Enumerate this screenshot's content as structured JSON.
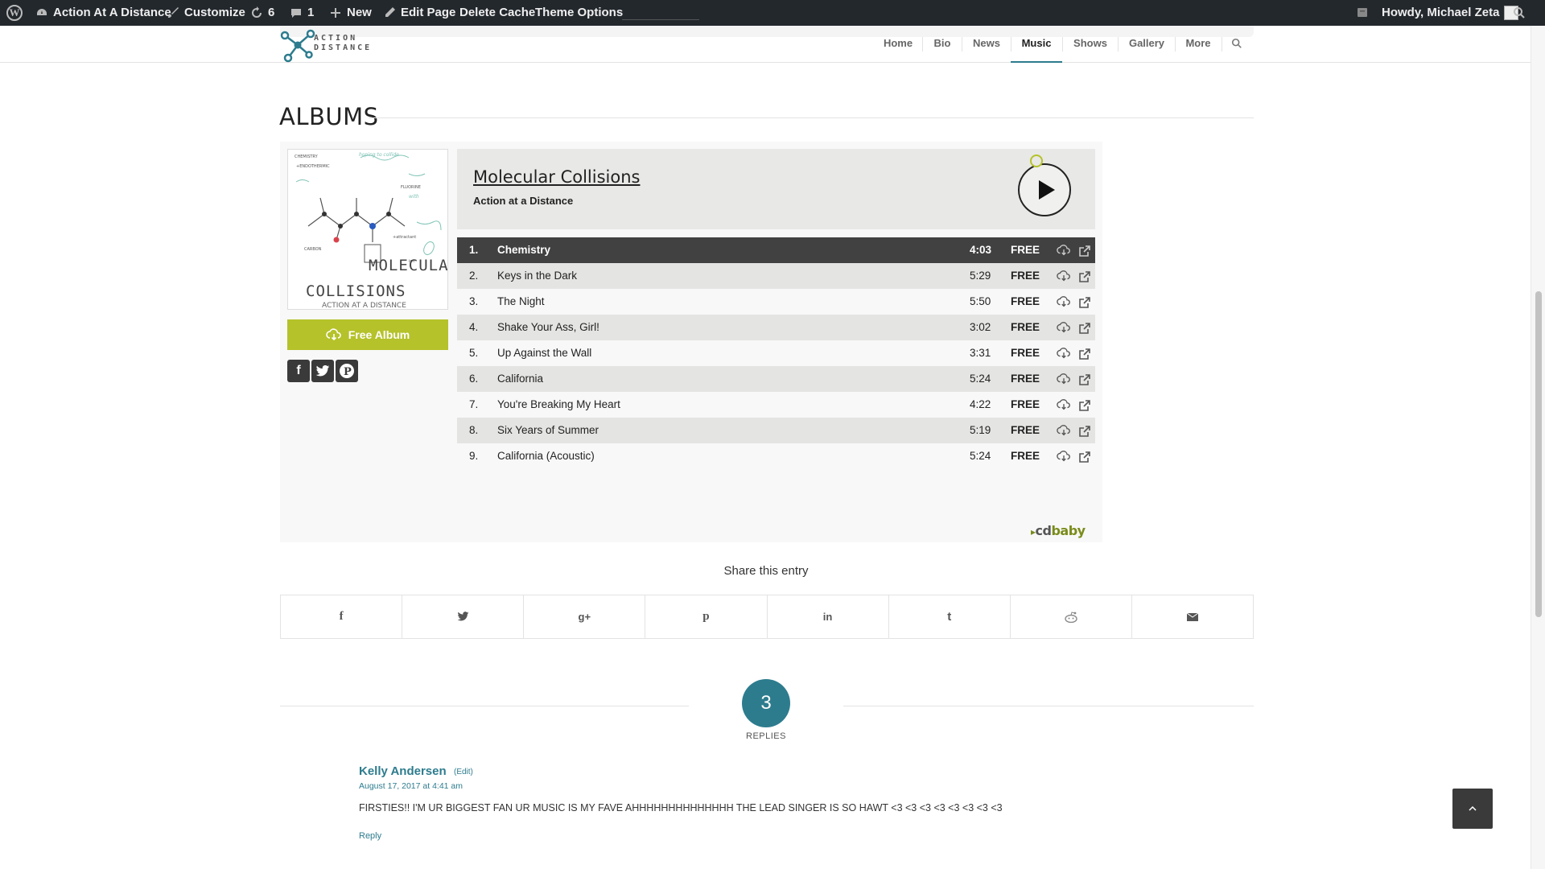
{
  "adminbar": {
    "site_name": "Action At A Distance",
    "customize": "Customize",
    "updates_count": "6",
    "comments_count": "1",
    "new_label": "New",
    "edit_page": "Edit Page",
    "delete_cache": "Delete Cache",
    "theme_options": "Theme Options",
    "howdy": "Howdy, Michael Zeta"
  },
  "header": {
    "logo_text_1": "ACTION",
    "logo_text_2": "DISTANCE",
    "nav": [
      "Home",
      "Bio",
      "News",
      "Music",
      "Shows",
      "Gallery",
      "More"
    ],
    "active_nav": "Music"
  },
  "albums": {
    "heading": "ALBUMS",
    "album_title": "Molecular Collisions",
    "artist": "Action at a Distance",
    "free_album_label": "Free Album",
    "cover_text_1": "MOLECULAR",
    "cover_text_2": "COLLISIONS",
    "cover_text_3": "ACTION AT A DISTANCE",
    "tracks": [
      {
        "num": "1.",
        "name": "Chemistry",
        "duration": "4:03",
        "price": "FREE"
      },
      {
        "num": "2.",
        "name": "Keys in the Dark",
        "duration": "5:29",
        "price": "FREE"
      },
      {
        "num": "3.",
        "name": "The Night",
        "duration": "5:50",
        "price": "FREE"
      },
      {
        "num": "4.",
        "name": "Shake Your Ass, Girl!",
        "duration": "3:02",
        "price": "FREE"
      },
      {
        "num": "5.",
        "name": "Up Against the Wall",
        "duration": "3:31",
        "price": "FREE"
      },
      {
        "num": "6.",
        "name": "California",
        "duration": "5:24",
        "price": "FREE"
      },
      {
        "num": "7.",
        "name": "You're Breaking My Heart",
        "duration": "4:22",
        "price": "FREE"
      },
      {
        "num": "8.",
        "name": "Six Years of Summer",
        "duration": "5:19",
        "price": "FREE"
      },
      {
        "num": "9.",
        "name": "California (Acoustic)",
        "duration": "5:24",
        "price": "FREE"
      }
    ],
    "cdbaby_cd": "cd",
    "cdbaby_baby": "baby"
  },
  "share": {
    "title": "Share this entry",
    "networks": [
      "facebook",
      "twitter",
      "google-plus",
      "pinterest",
      "linkedin",
      "tumblr",
      "reddit",
      "mail"
    ]
  },
  "replies": {
    "count": "3",
    "label": "REPLIES"
  },
  "comment": {
    "author": "Kelly Andersen",
    "edit": "(Edit)",
    "date": "August 17, 2017 at 4:41 am",
    "body": "FIRSTIES!! I'M UR BIGGEST FAN UR MUSIC IS MY FAVE AHHHHHHHHHHHHHH THE LEAD SINGER IS SO HAWT <3 <3 <3 <3 <3 <3 <3 <3",
    "reply": "Reply"
  },
  "colors": {
    "accent": "#2d7c8e",
    "lime": "#b5c22a",
    "adminbar": "#23282d"
  }
}
